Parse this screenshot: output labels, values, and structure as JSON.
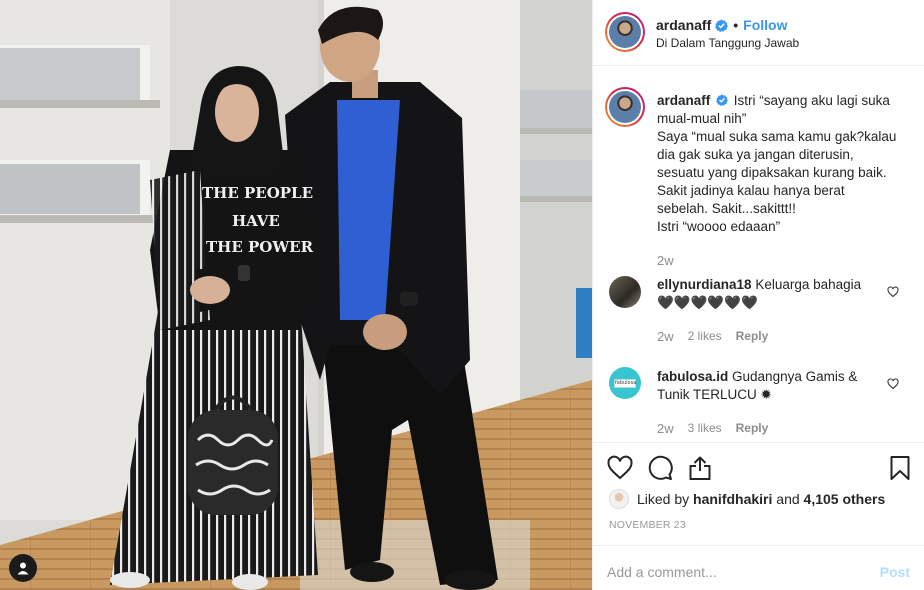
{
  "post": {
    "username": "ardanaff",
    "follow_label": "Follow",
    "separator": "•",
    "location": "Di Dalam Tanggung Jawab",
    "shirt_text": [
      "THE PEOPLE",
      "HAVE",
      "THE POWER"
    ],
    "caption": {
      "username": "ardanaff",
      "lines": [
        "Istri “sayang aku lagi suka",
        "mual-mual nih”",
        "Saya “mual suka sama kamu gak?kalau",
        "dia gak suka ya jangan diterusin,",
        "sesuatu yang dipaksakan kurang baik.",
        "Sakit jadinya kalau hanya berat",
        "sebelah. Sakit...sakittt!!",
        "Istri “woooo edaaan”"
      ],
      "age": "2w"
    },
    "comments": [
      {
        "username": "ellynurdiana18",
        "text_line1": "Keluarga bahagia",
        "text_line2": "🖤🖤🖤🖤🖤🖤",
        "age": "2w",
        "likes": "2 likes",
        "reply": "Reply"
      },
      {
        "username": "fabulosa.id",
        "text_line1": "Gudangnya Gamis &",
        "text_line2": "Tunik TERLUCU ✹",
        "age": "2w",
        "likes": "3 likes",
        "reply": "Reply",
        "avatar_text": "fabulosa"
      }
    ],
    "liked_by": {
      "prefix": "Liked by",
      "user": "hanifdhakiri",
      "middle": "and",
      "others": "4,105 others"
    },
    "date": "NOVEMBER 23",
    "add_comment_placeholder": "Add a comment...",
    "post_label": "Post"
  },
  "colors": {
    "accent": "#3897f0",
    "post_disabled": "#b2dffc",
    "muted": "#8e8e8e"
  },
  "icons": {
    "verified": "verified-badge-icon",
    "heart": "heart-icon",
    "comment": "comment-icon",
    "share": "share-icon",
    "save": "bookmark-icon",
    "tag": "user-tag-icon"
  }
}
